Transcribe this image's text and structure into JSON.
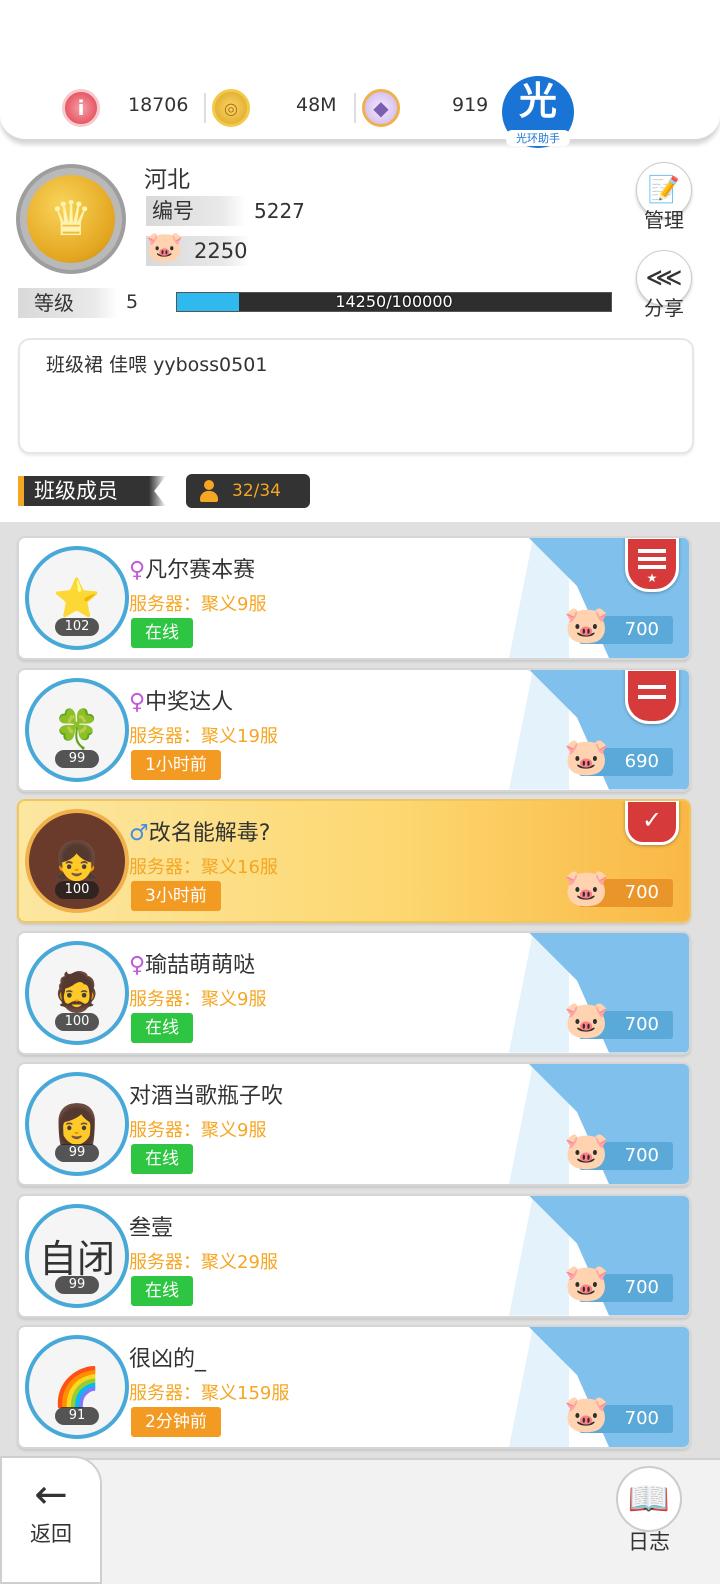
{
  "currencies": [
    {
      "icon": "ruby-coin-icon",
      "value": "18706"
    },
    {
      "icon": "gold-coin-icon",
      "value": "48M"
    },
    {
      "icon": "crystal-pacifier-icon",
      "value": "919"
    }
  ],
  "helper": {
    "big": "光",
    "small": "光环助手"
  },
  "guild": {
    "name": "河北",
    "id_label": "编号",
    "id_value": "5227",
    "funds": "2250",
    "level_label": "等级",
    "level": "5",
    "exp_text": "14250/100000",
    "exp_progress": 0.1425,
    "notice": "班级裙 佳喂 yyboss0501"
  },
  "side": {
    "manage": "管理",
    "share": "分享"
  },
  "members_section": {
    "title": "班级成员",
    "count": "32/34"
  },
  "members": [
    {
      "gender": "♀",
      "name": "凡尔赛本赛",
      "server": "服务器：聚义9服",
      "status": "在线",
      "status_type": "online",
      "level": "102",
      "contrib": "700",
      "badge": "red3",
      "avatar": "⭐"
    },
    {
      "gender": "♀",
      "name": "中奖达人",
      "server": "服务器：聚义19服",
      "status": "1小时前",
      "status_type": "away",
      "level": "99",
      "contrib": "690",
      "badge": "red2",
      "avatar": "🍀"
    },
    {
      "gender": "♂",
      "name": "改名能解毒?",
      "server": "服务器：聚义16服",
      "status": "3小时前",
      "status_type": "away",
      "level": "100",
      "contrib": "700",
      "badge": "v",
      "avatar": "👧",
      "highlight": true
    },
    {
      "gender": "♀",
      "name": "瑜喆萌萌哒",
      "server": "服务器：聚义9服",
      "status": "在线",
      "status_type": "online",
      "level": "100",
      "contrib": "700",
      "badge": "",
      "avatar": "🧔"
    },
    {
      "gender": "",
      "name": "对酒当歌瓶子吹",
      "server": "服务器：聚义9服",
      "status": "在线",
      "status_type": "online",
      "level": "99",
      "contrib": "700",
      "badge": "",
      "avatar": "👩"
    },
    {
      "gender": "",
      "name": "叁壹",
      "server": "服务器：聚义29服",
      "status": "在线",
      "status_type": "online",
      "level": "99",
      "contrib": "700",
      "badge": "",
      "avatar": "自闭"
    },
    {
      "gender": "",
      "name": "很凶的_",
      "server": "服务器：聚义159服",
      "status": "2分钟前",
      "status_type": "away",
      "level": "91",
      "contrib": "700",
      "badge": "",
      "avatar": "🌈"
    }
  ],
  "bottom": {
    "back": "返回",
    "log": "日志"
  }
}
